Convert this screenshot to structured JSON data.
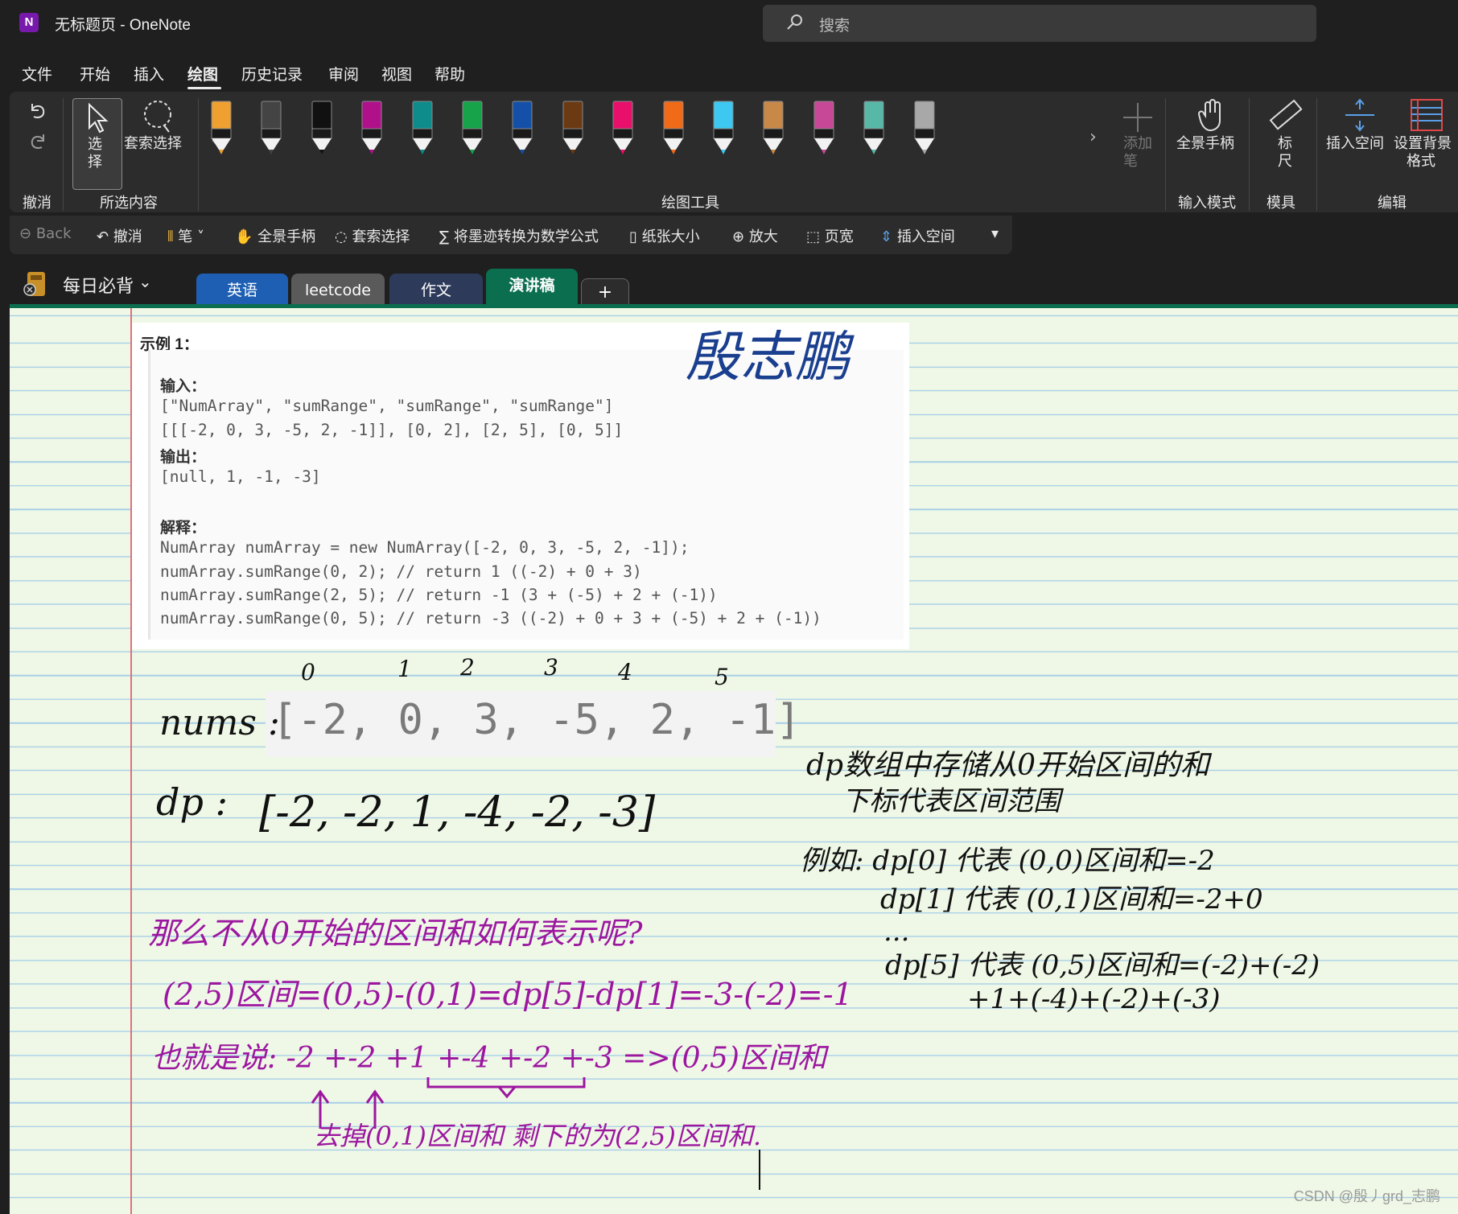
{
  "window": {
    "title": "无标题页 - OneNote",
    "app_logo": "N"
  },
  "search": {
    "placeholder": "搜索"
  },
  "menu": {
    "items": [
      "文件",
      "开始",
      "插入",
      "绘图",
      "历史记录",
      "审阅",
      "视图",
      "帮助"
    ],
    "active": "绘图"
  },
  "ribbon": {
    "undo_group_label": "撤消",
    "select_label_1": "选",
    "select_label_2": "择",
    "lasso_label": "套索选择",
    "selection_group_label": "所选内容",
    "pens": [
      {
        "color": "#f0a030",
        "tip": "highlighter"
      },
      {
        "color": "#444444",
        "tip": "text-pen"
      },
      {
        "color": "#111111",
        "tip": "pen"
      },
      {
        "color": "#b0108a",
        "tip": "pen"
      },
      {
        "color": "#0e8c8c",
        "tip": "pen"
      },
      {
        "color": "#16a34a",
        "tip": "pen"
      },
      {
        "color": "#1550a8",
        "tip": "pen"
      },
      {
        "color": "#6b3a12",
        "tip": "pen"
      },
      {
        "color": "#e8106a",
        "tip": "pen"
      },
      {
        "color": "#f06a18",
        "tip": "pen"
      },
      {
        "color": "#3cc8f0",
        "tip": "pen"
      },
      {
        "color": "#c88848",
        "tip": "texture-wood"
      },
      {
        "color": "#c84898",
        "tip": "texture-rainbow"
      },
      {
        "color": "#58b8a8",
        "tip": "texture-galaxy"
      },
      {
        "color": "#a8a8a8",
        "tip": "highlighter"
      }
    ],
    "add_pen_1": "添加",
    "add_pen_2": "笔",
    "drawing_tools_label": "绘图工具",
    "pan_label": "全景手柄",
    "input_mode_label": "输入模式",
    "ruler_1": "标",
    "ruler_2": "尺",
    "stencil_label": "模具",
    "insert_space_label": "插入空间",
    "bg_format_1": "设置背景",
    "bg_format_2": "格式",
    "edit_label": "编辑"
  },
  "quick_access": {
    "back": "Back",
    "undo": "撤消",
    "pen": "笔",
    "pan": "全景手柄",
    "lasso": "套索选择",
    "ink_to_math": "将墨迹转换为数学公式",
    "paper_size": "纸张大小",
    "zoom_in": "放大",
    "page_width": "页宽",
    "insert_space": "插入空间"
  },
  "notebook": {
    "name": "每日必背",
    "tabs": [
      {
        "label": "英语",
        "color": "#1e5fb4",
        "active": false
      },
      {
        "label": "leetcode",
        "color": "#5a5a5a",
        "active": false
      },
      {
        "label": "作文",
        "color": "#2d3a5a",
        "active": false
      },
      {
        "label": "演讲稿",
        "color": "#0b6e4f",
        "active": true
      }
    ],
    "add_tab": "+"
  },
  "example": {
    "title": "示例 1：",
    "input_label": "输入：",
    "input_line1": "[\"NumArray\", \"sumRange\", \"sumRange\", \"sumRange\"]",
    "input_line2": "[[[-2, 0, 3, -5, 2, -1]], [0, 2], [2, 5], [0, 5]]",
    "output_label": "输出：",
    "output_line": "[null, 1, -1, -3]",
    "explain_label": "解释：",
    "explain_lines": [
      "NumArray numArray = new NumArray([-2, 0, 3, -5, 2, -1]);",
      "numArray.sumRange(0, 2); // return 1 ((-2) + 0 + 3)",
      "numArray.sumRange(2, 5); // return -1 (3 + (-5) + 2 + (-1))",
      "numArray.sumRange(0, 5); // return -3 ((-2) + 0 + 3 + (-5) + 2 + (-1))"
    ]
  },
  "nums_array": "[-2, 0, 3, -5, 2, -1]",
  "handwriting": {
    "signature": "殷志鹏",
    "indices": [
      "0",
      "1",
      "2",
      "3",
      "4",
      "5"
    ],
    "nums_label": "nums :",
    "dp_label": "dp  :",
    "dp_values": "[-2, -2, 1, -4, -2, -3]",
    "note_1": "dp数组中存储从0开始区间的和",
    "note_2": "下标代表区间范围",
    "example_head": "例如: dp[0] 代表 (0,0)区间和=-2",
    "example_2": "dp[1] 代表 (0,1)区间和=-2+0",
    "ellipsis": "...",
    "example_3": "dp[5] 代表 (0,5)区间和=(-2)+(-2)",
    "example_4": "+1+(-4)+(-2)+(-3)",
    "question": "那么不从0开始的区间和如何表示呢?",
    "formula": "(2,5)区间=(0,5)-(0,1)=dp[5]-dp[1]=-3-(-2)=-1",
    "in_other_words": "也就是说: -2 +-2 +1 +-4 +-2 +-3 =>(0,5)区间和",
    "remove_note": "去掉(0,1)区间和",
    "remain_note": "剩下的为(2,5)区间和."
  },
  "colors": {
    "accent_green": "#0b6e4f",
    "ink_black": "#111111",
    "ink_purple": "#9c16a0",
    "ink_blue": "#1a3f8f",
    "margin_red": "#e0707a"
  },
  "watermark": "CSDN @殷丿grd_志鹏"
}
